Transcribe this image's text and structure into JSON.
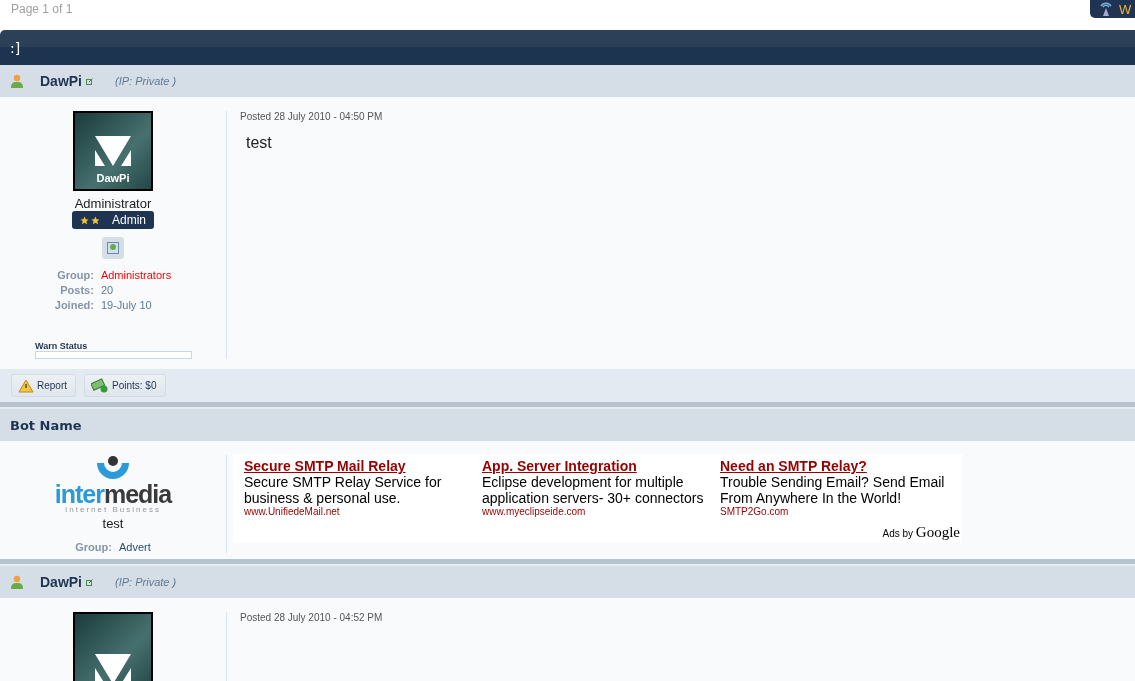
{
  "pagination": "Page 1 of 1",
  "corner_button": {
    "label": "W"
  },
  "topic_title": ":]",
  "posts": [
    {
      "kind": "member",
      "author": "DawPi",
      "ip": "(IP: Private )",
      "posted": "Posted 28 July 2010 - 04:50 PM",
      "avatar_label": "DawPi",
      "title": "Administrator",
      "rank": {
        "label": "Admin"
      },
      "fields": [
        {
          "label": "Group:",
          "value": "Administrators",
          "color": "#ff0000"
        },
        {
          "label": "Posts:",
          "value": "20"
        },
        {
          "label": "Joined:",
          "value": "19-July 10"
        }
      ],
      "warn_label": "Warn Status",
      "warn": {
        "level": 0
      },
      "body": "test",
      "buttons": [
        {
          "kind": "report",
          "label": "Report"
        },
        {
          "kind": "points",
          "label": "Points: $0"
        }
      ]
    },
    {
      "kind": "bot",
      "header": "Bot Name",
      "logo": {
        "word_start": "inter",
        "word_end": "media",
        "tagline": "Internet Business"
      },
      "name": "test",
      "fields": [
        {
          "label": "Group:",
          "value": "Advert",
          "color": "#2b4d73"
        }
      ],
      "ads": [
        {
          "title": "Secure SMTP Mail Relay",
          "text": "Secure SMTP Relay Service for business & personal use.",
          "url": "www.UnifiedeMail.net"
        },
        {
          "title": "App. Server Integration",
          "text": "Eclipse development for multiple application servers- 30+ connectors",
          "url": "www.myeclipseide.com"
        },
        {
          "title": "Need an SMTP Relay?",
          "text": "Trouble Sending Email? Send Email From Anywhere In the World!",
          "url": "SMTP2Go.com"
        }
      ],
      "ads_credit": {
        "prefix": "Ads by",
        "brand": "Google"
      }
    },
    {
      "kind": "member",
      "author": "DawPi",
      "ip": "(IP: Private )",
      "posted": "Posted 28 July 2010 - 04:52 PM"
    }
  ]
}
